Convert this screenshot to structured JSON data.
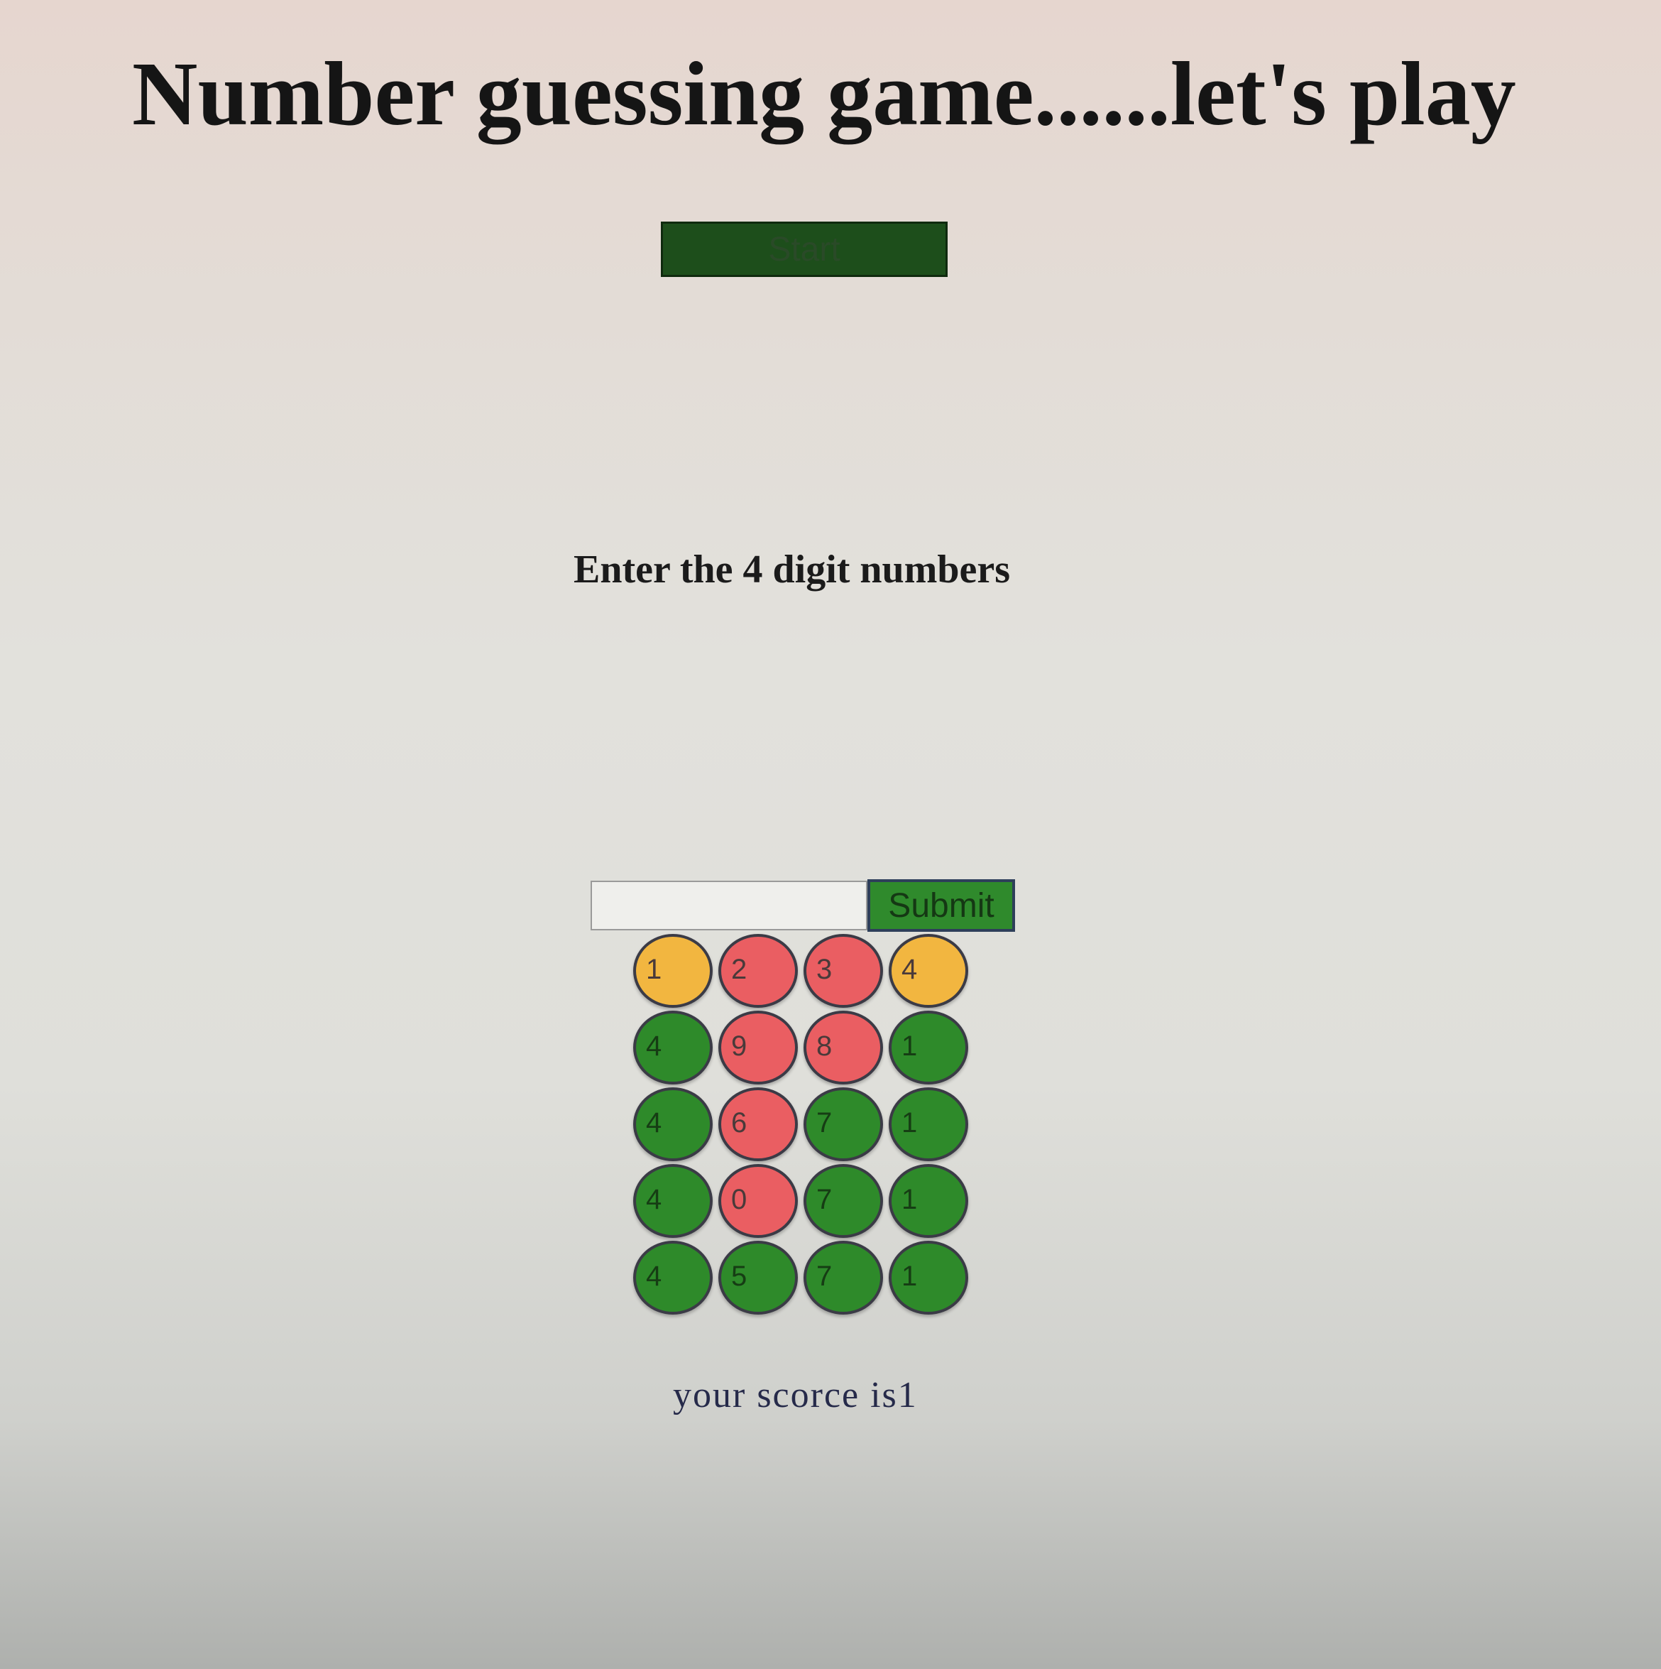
{
  "header": {
    "title": "Number guessing game......let's play"
  },
  "controls": {
    "start_label": "Start",
    "instruction": "Enter the 4 digit numbers",
    "input_value": "",
    "submit_label": "Submit"
  },
  "board": {
    "rows": [
      [
        {
          "digit": "1",
          "status": "yellow"
        },
        {
          "digit": "2",
          "status": "red"
        },
        {
          "digit": "3",
          "status": "red"
        },
        {
          "digit": "4",
          "status": "yellow"
        }
      ],
      [
        {
          "digit": "4",
          "status": "green"
        },
        {
          "digit": "9",
          "status": "red"
        },
        {
          "digit": "8",
          "status": "red"
        },
        {
          "digit": "1",
          "status": "green"
        }
      ],
      [
        {
          "digit": "4",
          "status": "green"
        },
        {
          "digit": "6",
          "status": "red"
        },
        {
          "digit": "7",
          "status": "green"
        },
        {
          "digit": "1",
          "status": "green"
        }
      ],
      [
        {
          "digit": "4",
          "status": "green"
        },
        {
          "digit": "0",
          "status": "red"
        },
        {
          "digit": "7",
          "status": "green"
        },
        {
          "digit": "1",
          "status": "green"
        }
      ],
      [
        {
          "digit": "4",
          "status": "green"
        },
        {
          "digit": "5",
          "status": "green"
        },
        {
          "digit": "7",
          "status": "green"
        },
        {
          "digit": "1",
          "status": "green"
        }
      ]
    ],
    "colors": {
      "yellow": "#f2b640",
      "red": "#ea5e62",
      "green": "#2e8a2a"
    }
  },
  "footer": {
    "score_text": "your scorce is1"
  }
}
